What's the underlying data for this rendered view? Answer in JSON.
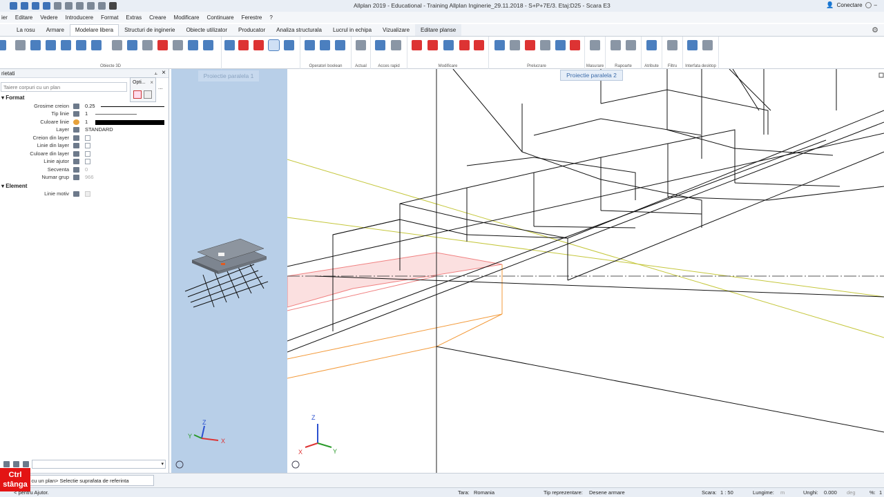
{
  "app": {
    "title": "Allplan 2019 - Educational - Training Allplan Inginerie_29.11.2018 - S+P+7E/3. Etaj:D25 - Scara E3",
    "connect_label": "Conectare",
    "help_label": "?"
  },
  "menu": [
    "ier",
    "Editare",
    "Vedere",
    "Introducere",
    "Format",
    "Extras",
    "Creare",
    "Modificare",
    "Continuare",
    "Ferestre",
    "?"
  ],
  "tabs": [
    "La rosu",
    "Armare",
    "Modelare libera",
    "Structuri de inginerie",
    "Obiecte utilizator",
    "Producator",
    "Analiza structurala",
    "Lucrul in echipa",
    "Vizualizare",
    "Editare planse"
  ],
  "active_tab": "Modelare libera",
  "ribbon_groups": [
    "Obiecte 3D",
    "Operatori boolean",
    "Actual",
    "Acces rapid",
    "Modificare",
    "Prelucrare",
    "Masurare",
    "Rapoarte",
    "Atribute",
    "Filtru",
    "Interfata desktop"
  ],
  "left_panel": {
    "title": "rietati",
    "pin": "⫠",
    "close": "×",
    "search_placeholder": "Taiere corpuri cu un plan",
    "options_popup": {
      "title": "Opti...",
      "close": "×"
    },
    "ellipsis": "...",
    "format_section": "Format",
    "element_section": "Element",
    "properties": [
      {
        "label": "Grosime creion",
        "value": "0.25"
      },
      {
        "label": "Tip linie",
        "value": "1"
      },
      {
        "label": "Culoare linie",
        "value": "1"
      },
      {
        "label": "Layer",
        "value": "STANDARD"
      },
      {
        "label": "Creion din layer",
        "value": ""
      },
      {
        "label": "Linie din layer",
        "value": ""
      },
      {
        "label": "Culoare din layer",
        "value": ""
      },
      {
        "label": "Linie ajutor",
        "value": ""
      },
      {
        "label": "Secventa",
        "value": "0"
      },
      {
        "label": "Numar grup",
        "value": "966"
      }
    ],
    "element_properties": [
      {
        "label": "Linie motiv",
        "value": ""
      }
    ]
  },
  "viewports": {
    "left_label": "Proiectie paralela 1",
    "right_label": "Proiectie paralela 2",
    "axis_z": "Z",
    "axis_x": "X",
    "axis_y": "Y"
  },
  "command": {
    "prompt": "uri cu un plan> Selectie suprafata de referinta",
    "hint": "< pentru Ajutor."
  },
  "key_overlay": {
    "line1": "Ctrl",
    "line2": "stânga"
  },
  "status": {
    "tara_label": "Tara:",
    "tara_value": "Romania",
    "tip_label": "Tip reprezentare:",
    "tip_value": "Desene armare",
    "scara_label": "Scara:",
    "scara_value": "1 : 50",
    "lungime_label": "Lungime:",
    "lungime_unit": "m",
    "unghi_label": "Unghi:",
    "unghi_value": "0.000",
    "unghi_unit": "deg",
    "percent_label": "%:",
    "percent_value": "1"
  },
  "colors": {
    "accent": "#4b7fbf",
    "viewport_left_bg": "#b8cfe8",
    "red_surface": "#f08080",
    "orange_lines": "#f39a3a",
    "olive_lines": "#c4c63a",
    "badge_red": "#e31414"
  },
  "icons": [
    "save-icon",
    "undo-icon",
    "redo-icon",
    "gear-icon",
    "help-icon",
    "user-icon",
    "close-icon",
    "pin-icon",
    "navigation-cube-icon"
  ]
}
